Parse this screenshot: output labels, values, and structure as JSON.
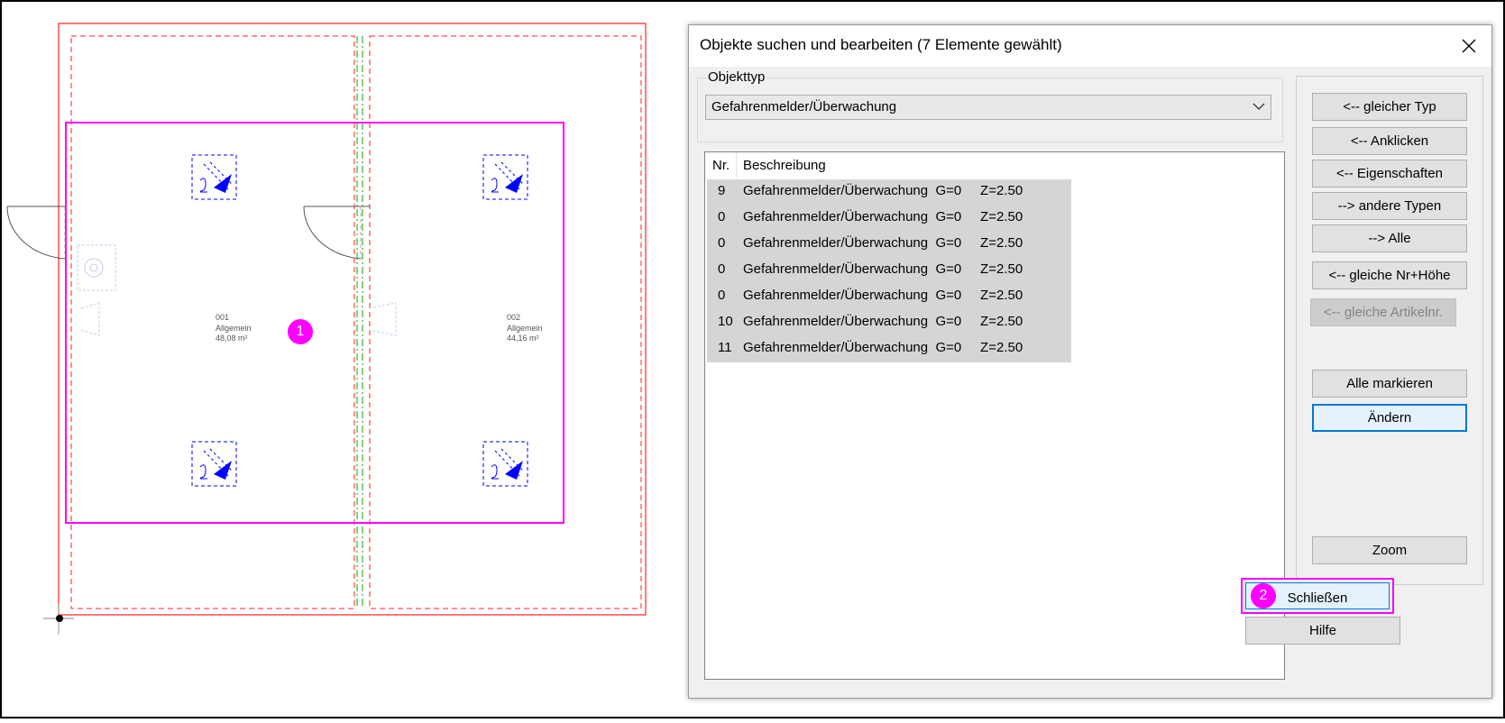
{
  "drawing": {
    "rooms": [
      {
        "number": "001",
        "name": "Allgemein",
        "area": "48,08 m²"
      },
      {
        "number": "002",
        "name": "Allgemein",
        "area": "44,16 m²"
      }
    ],
    "markers": {
      "m1": "1",
      "m2": "2"
    },
    "colors": {
      "wall": "#ff2020",
      "selection": "#ff00ff",
      "detector": "#0000ff",
      "axis": "#00aa00"
    }
  },
  "dialog": {
    "title": "Objekte suchen und bearbeiten (7 Elemente gewählt)",
    "group_label": "Objekttyp",
    "type_value": "Gefahrenmelder/Überwachung",
    "list": {
      "headers": {
        "nr": "Nr.",
        "desc": "Beschreibung"
      },
      "rows": [
        {
          "nr": "9",
          "desc": "Gefahrenmelder/Überwachung  G=0     Z=2.50"
        },
        {
          "nr": "0",
          "desc": "Gefahrenmelder/Überwachung  G=0     Z=2.50"
        },
        {
          "nr": "0",
          "desc": "Gefahrenmelder/Überwachung  G=0     Z=2.50"
        },
        {
          "nr": "0",
          "desc": "Gefahrenmelder/Überwachung  G=0     Z=2.50"
        },
        {
          "nr": "0",
          "desc": "Gefahrenmelder/Überwachung  G=0     Z=2.50"
        },
        {
          "nr": "10",
          "desc": "Gefahrenmelder/Überwachung  G=0     Z=2.50"
        },
        {
          "nr": "11",
          "desc": "Gefahrenmelder/Überwachung  G=0     Z=2.50"
        }
      ]
    },
    "buttons": {
      "gleicher_typ": "<-- gleicher Typ",
      "anklicken": "<-- Anklicken",
      "eigenschaften": "<-- Eigenschaften",
      "andere_typen": "--> andere Typen",
      "alle": "--> Alle",
      "gleiche_nr_hoehe": "<-- gleiche Nr+Höhe",
      "gleiche_artikelnr": "<-- gleiche Artikelnr.",
      "alle_markieren": "Alle markieren",
      "aendern": "Ändern",
      "zoom": "Zoom",
      "schliessen": "Schließen",
      "hilfe": "Hilfe"
    }
  }
}
